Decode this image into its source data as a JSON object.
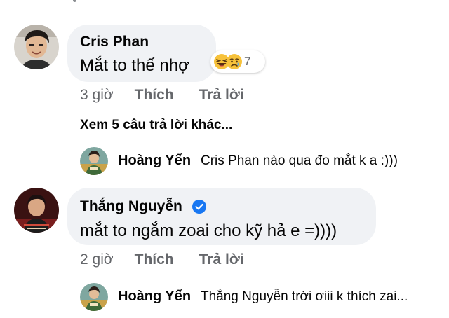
{
  "comments": [
    {
      "author": "Cris Phan",
      "text": "Mắt to thế nhợ",
      "reactions": {
        "icons": [
          "laughing-emoji",
          "sad-emoji"
        ],
        "count": "7"
      },
      "actions": {
        "time": "3 giờ",
        "like_label": "Thích",
        "reply_label": "Trả lời"
      },
      "more_replies_label": "Xem 5 câu trả lời khác...",
      "reply": {
        "author": "Hoàng Yến",
        "text": "Cris Phan nào qua đo mắt k a :)))"
      }
    },
    {
      "author": "Thắng Nguyễn",
      "verified": true,
      "text": "mắt to ngắm zoai cho kỹ hả e =))))",
      "actions": {
        "time": "2 giờ",
        "like_label": "Thích",
        "reply_label": "Trả lời"
      },
      "reply": {
        "author": "Hoàng Yến",
        "text": "Thắng Nguyễn trời ơiii k thích zai..."
      }
    }
  ],
  "colors": {
    "bubble_bg": "#f0f2f5",
    "secondary_text": "#65676b",
    "verified_blue": "#1877f2"
  }
}
